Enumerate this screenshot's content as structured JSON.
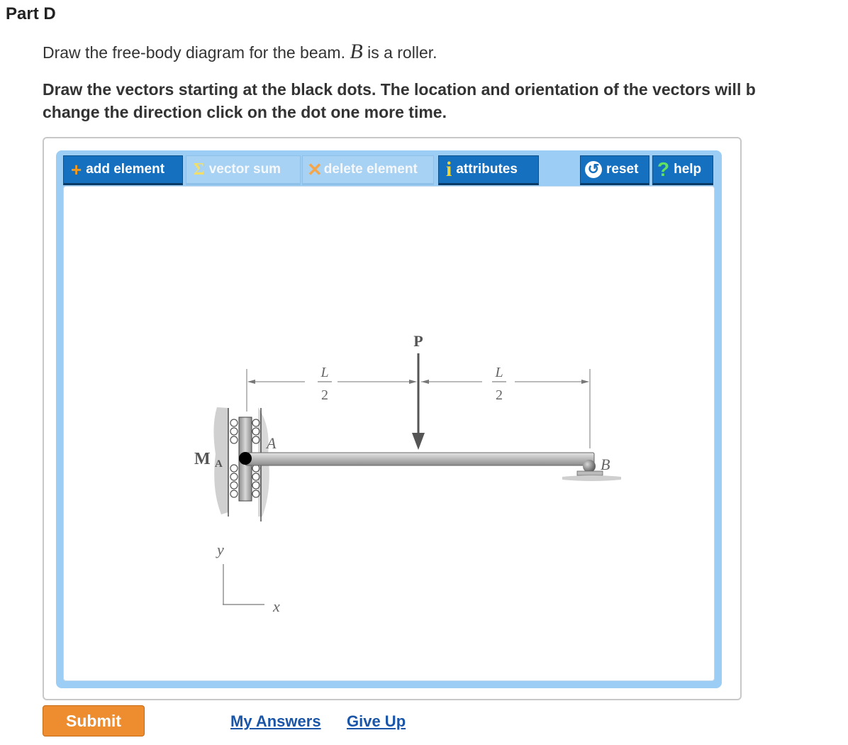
{
  "part_title": "Part D",
  "prompt": {
    "before": "Draw the free-body diagram for the beam. ",
    "var": "B",
    "after": " is a roller."
  },
  "instructions": {
    "line1": "Draw the vectors starting at the black dots. The location and orientation of the vectors will b",
    "line2": "change the direction click on the dot one more time."
  },
  "toolbar": {
    "add_element": "add element",
    "vector_sum": "vector sum",
    "delete_element": "delete element",
    "attributes": "attributes",
    "reset": "reset",
    "help": "help"
  },
  "diagram": {
    "force_label": "P",
    "dim_num": "L",
    "dim_den": "2",
    "point_a": "A",
    "point_b": "B",
    "moment_label": "M",
    "moment_sub": "A",
    "axis_y": "y",
    "axis_x": "x"
  },
  "actions": {
    "submit": "Submit",
    "my_answers": "My Answers",
    "give_up": "Give Up"
  },
  "colors": {
    "toolbar_active": "#1570bf",
    "toolbar_frame": "#9ccdf5",
    "submit": "#ee8d30",
    "link": "#1a55a8"
  }
}
